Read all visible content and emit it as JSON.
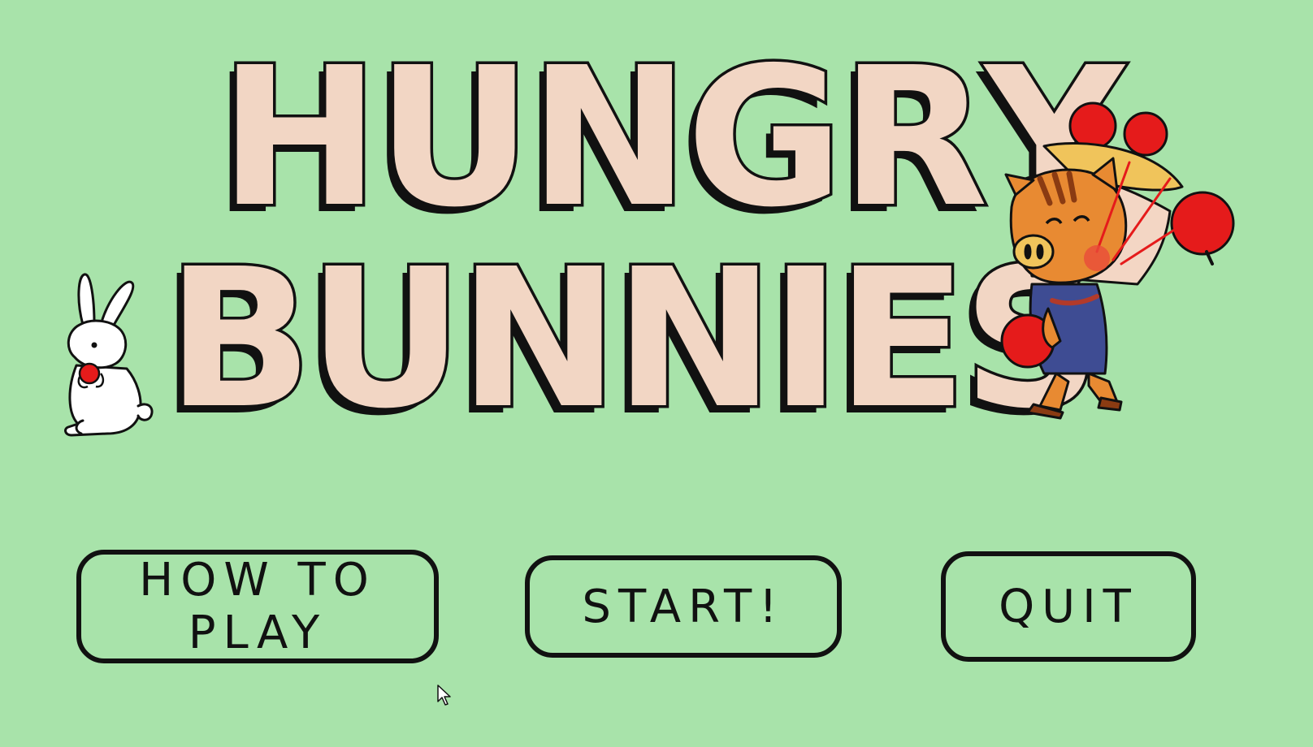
{
  "title": {
    "line1": [
      "H",
      "U",
      "N",
      "G",
      "R",
      "Y"
    ],
    "line2": [
      "B",
      "U",
      "N",
      "N",
      "I",
      "E",
      "S"
    ]
  },
  "menu": {
    "how_to_play": "HOW TO PLAY",
    "start": "START!",
    "quit": "QUIT"
  },
  "icons": {
    "bunny": "bunny-with-apple-icon",
    "boar": "boar-carrying-apples-icon",
    "cursor": "mouse-pointer-icon"
  },
  "colors": {
    "background": "#a8e3aa",
    "title_fill": "#f2d6c4",
    "outline": "#111111",
    "apple": "#e51b1b"
  }
}
